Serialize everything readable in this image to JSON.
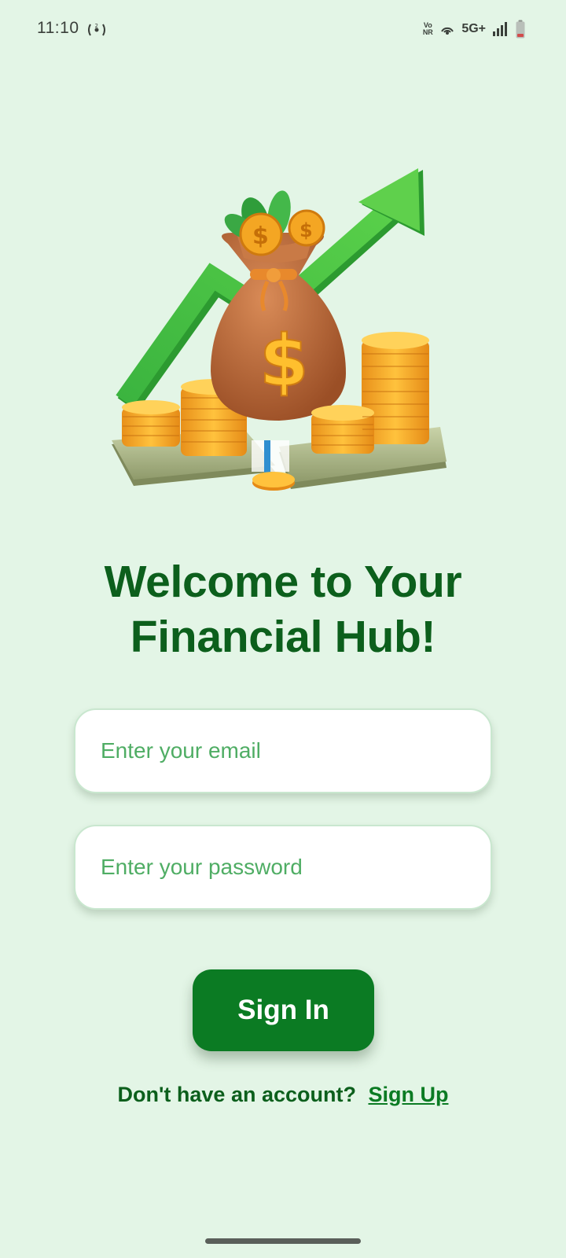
{
  "status_bar": {
    "time": "11:10",
    "vonr_top": "Vo",
    "vonr_bottom": "NR",
    "network": "5G+",
    "icons": [
      "hotspot-icon",
      "vonr-icon",
      "wifi-calling-icon",
      "signal-icon",
      "battery-icon"
    ]
  },
  "hero": {
    "icon": "money-bag-growth-illustration"
  },
  "welcome": {
    "title_line1": "Welcome to Your",
    "title_line2": "Financial Hub!"
  },
  "form": {
    "email_placeholder": "Enter your email",
    "email_value": "",
    "password_placeholder": "Enter your password",
    "password_value": "",
    "signin_label": "Sign In"
  },
  "footer": {
    "prompt": "Don't have an account?",
    "signup_label": "Sign Up"
  },
  "colors": {
    "background": "#e3f5e6",
    "primary": "#0b7b23",
    "title": "#0c5f1c",
    "placeholder": "#4fad64"
  }
}
